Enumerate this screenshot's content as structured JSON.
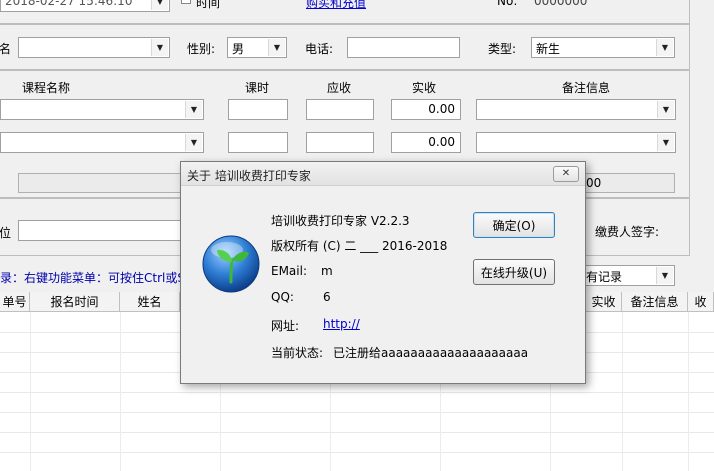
{
  "top_row": {
    "date_value": "2018-02-27 15:46:10",
    "time_label": "时间",
    "link_text": "购买和充值",
    "no_label": "No:",
    "no_value": "0000000"
  },
  "form": {
    "name_label": "名",
    "name_value": "",
    "gender_label": "性别:",
    "gender_value": "男",
    "phone_label": "电话:",
    "phone_value": "",
    "type_label": "类型:",
    "type_value": "新生"
  },
  "course_table": {
    "headers": {
      "course": "课程名称",
      "hours": "课时",
      "due": "应收",
      "paid": "实收",
      "note": "备注信息"
    },
    "rows": [
      {
        "paid": "0.00"
      },
      {
        "paid": "0.00"
      }
    ],
    "total_value": "00"
  },
  "lower": {
    "unit_label": "位",
    "signature_label": "缴费人签字:",
    "hint_text": "录：右键功能菜单：可按住Ctrl或Sh",
    "records_label": "有记录"
  },
  "records_table": {
    "headers": [
      "单号",
      "报名时间",
      "姓名",
      "实收",
      "备注信息",
      "收"
    ]
  },
  "dialog": {
    "title": "关于 培训收费打印专家",
    "product_name": "培训收费打印专家 V2.2.3",
    "copyright": "版权所有 (C) 二  ___  2016-2018",
    "email_label": "EMail:",
    "email_value": "           m",
    "qq_label": "QQ:",
    "qq_value": "6",
    "website_label": "网址:",
    "website_value": "http://",
    "status_label": "当前状态:",
    "status_value": "已注册给aaaaaaaaaaaaaaaaaaaa",
    "ok_button": "确定(O)",
    "upgrade_button": "在线升级(U)",
    "close_glyph": "✕"
  },
  "colors": {
    "link": "#0000cc",
    "hint": "#0000aa",
    "logo_blue": "#1f6fc8",
    "logo_green": "#3db83a"
  }
}
